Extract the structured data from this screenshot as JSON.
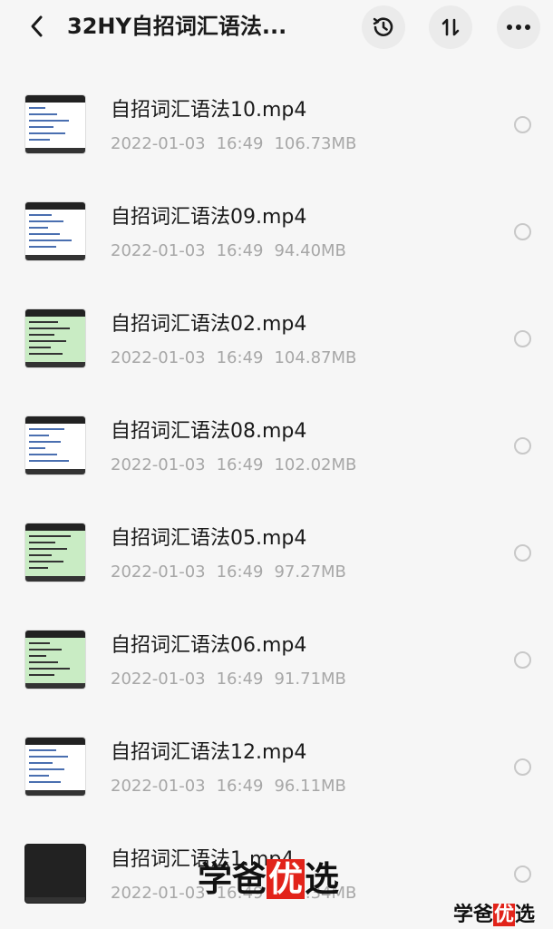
{
  "header": {
    "title": "32HY自招词汇语法..."
  },
  "icons": {
    "back": "chevron-left-icon",
    "history": "history-clock-icon",
    "sort": "sort-icon",
    "more": "more-horizontal-icon"
  },
  "files": [
    {
      "name": "自招词汇语法10.mp4",
      "date": "2022-01-03",
      "time": "16:49",
      "size": "106.73MB",
      "thumb": "white"
    },
    {
      "name": "自招词汇语法09.mp4",
      "date": "2022-01-03",
      "time": "16:49",
      "size": "94.40MB",
      "thumb": "white"
    },
    {
      "name": "自招词汇语法02.mp4",
      "date": "2022-01-03",
      "time": "16:49",
      "size": "104.87MB",
      "thumb": "green"
    },
    {
      "name": "自招词汇语法08.mp4",
      "date": "2022-01-03",
      "time": "16:49",
      "size": "102.02MB",
      "thumb": "white"
    },
    {
      "name": "自招词汇语法05.mp4",
      "date": "2022-01-03",
      "time": "16:49",
      "size": "97.27MB",
      "thumb": "green"
    },
    {
      "name": "自招词汇语法06.mp4",
      "date": "2022-01-03",
      "time": "16:49",
      "size": "91.71MB",
      "thumb": "green"
    },
    {
      "name": "自招词汇语法12.mp4",
      "date": "2022-01-03",
      "time": "16:49",
      "size": "96.11MB",
      "thumb": "white"
    },
    {
      "name": "自招词汇语法1.mp4",
      "date": "2022-01-03",
      "time": "16:49",
      "size": "104.34MB",
      "thumb": "dark"
    }
  ],
  "watermark": {
    "large_pre": "学爸",
    "large_hl": "优",
    "large_post": "选",
    "small_pre": "学爸",
    "small_hl": "优",
    "small_post": "选"
  },
  "colors": {
    "background": "#f6f6f6",
    "meta_text": "#a7a7a7",
    "watermark_red": "#e2231a"
  }
}
